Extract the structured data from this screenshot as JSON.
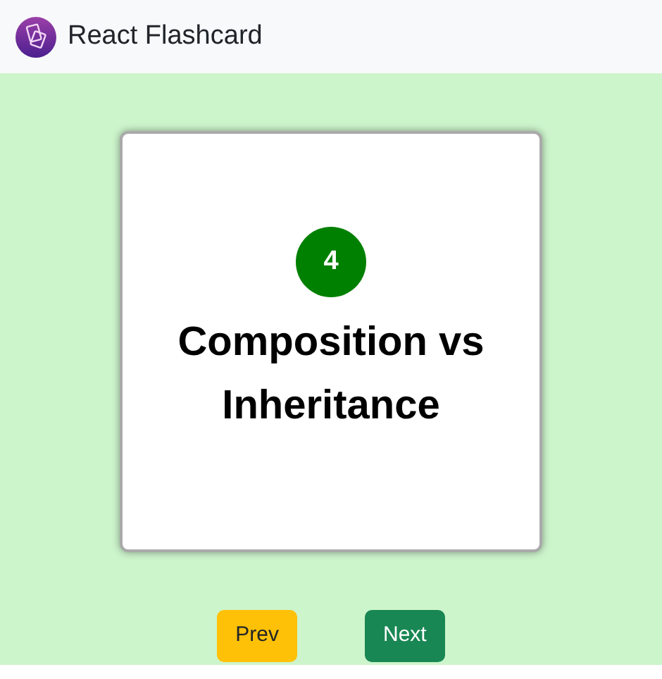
{
  "header": {
    "title": "React Flashcard"
  },
  "card": {
    "number": "4",
    "title": "Composition vs Inheritance"
  },
  "buttons": [
    {
      "label": "Prev",
      "kind": "warning"
    },
    {
      "label": "Next",
      "kind": "success"
    }
  ]
}
